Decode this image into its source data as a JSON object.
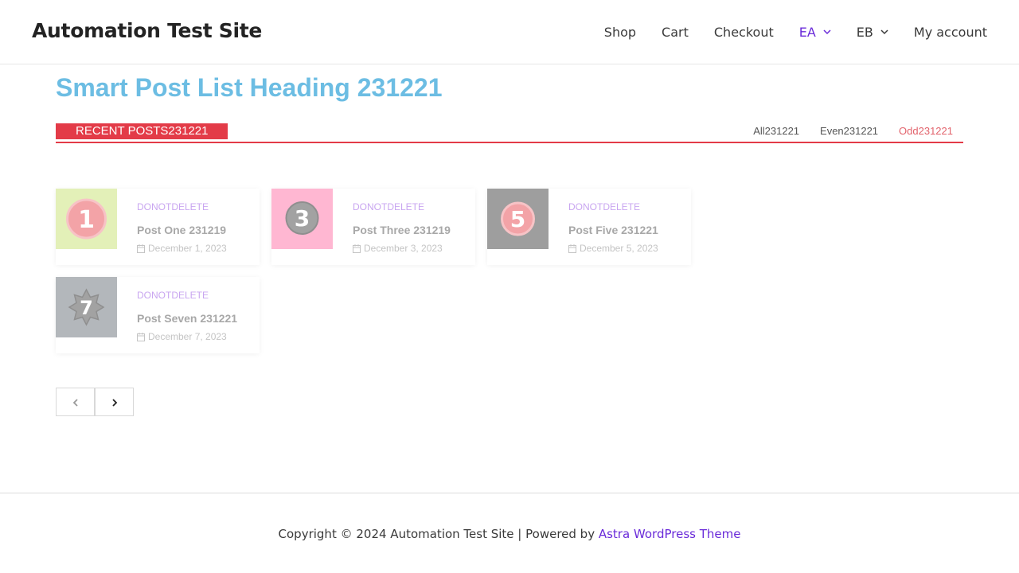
{
  "header": {
    "site_title": "Automation Test Site",
    "nav": [
      {
        "label": "Shop",
        "dropdown": false,
        "active": false
      },
      {
        "label": "Cart",
        "dropdown": false,
        "active": false
      },
      {
        "label": "Checkout",
        "dropdown": false,
        "active": false
      },
      {
        "label": "EA",
        "dropdown": true,
        "active": true
      },
      {
        "label": "EB",
        "dropdown": true,
        "active": false
      },
      {
        "label": "My account",
        "dropdown": false,
        "active": false
      }
    ]
  },
  "main": {
    "heading": "Smart Post List Heading 231221",
    "block_title": "RECENT POSTS231221",
    "filters": [
      {
        "label": "All231221",
        "selected": false
      },
      {
        "label": "Even231221",
        "selected": false
      },
      {
        "label": "Odd231221",
        "selected": true
      }
    ],
    "posts": [
      {
        "number": "1",
        "category": "DONOTDELETE",
        "title": "Post One 231219",
        "date": "December 1, 2023",
        "thumb_bg": "#e3f0b8",
        "badge_color": "#f3a3a7",
        "badge_shape": "circle"
      },
      {
        "number": "3",
        "category": "DONOTDELETE",
        "title": "Post Three 231219",
        "date": "December 3, 2023",
        "thumb_bg": "#ffb7d2",
        "badge_color": "#a2a2a2",
        "badge_shape": "circle"
      },
      {
        "number": "5",
        "category": "DONOTDELETE",
        "title": "Post Five 231221",
        "date": "December 5, 2023",
        "thumb_bg": "#9e9e9e",
        "badge_color": "#f3a3a7",
        "badge_shape": "circle"
      },
      {
        "number": "7",
        "category": "DONOTDELETE",
        "title": "Post Seven 231221",
        "date": "December 7, 2023",
        "thumb_bg": "#b3b7bb",
        "badge_color": "#a2a2a2",
        "badge_shape": "star"
      }
    ],
    "pagination": {
      "prev_icon": "chevron-left-icon",
      "next_icon": "chevron-right-icon",
      "prev_enabled": false,
      "next_enabled": true
    }
  },
  "footer": {
    "text": "Copyright © 2024 Automation Test Site | Powered by ",
    "link_label": "Astra WordPress Theme"
  },
  "colors": {
    "accent": "#6a2bd9",
    "heading": "#6cbde3",
    "block_red": "#e33b48",
    "filter_selected": "#e2626b"
  }
}
